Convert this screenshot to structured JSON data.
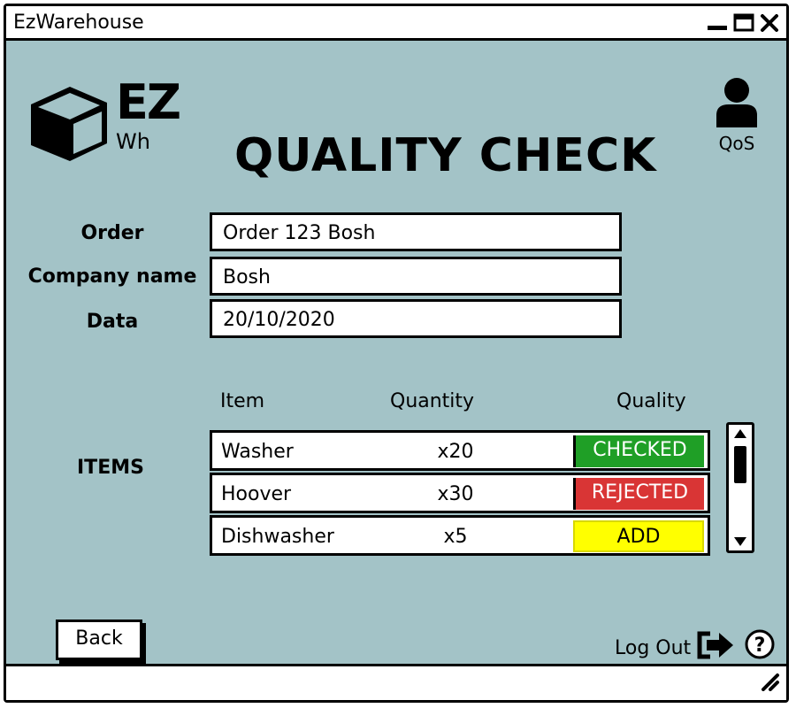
{
  "window": {
    "title": "EzWarehouse"
  },
  "logo": {
    "line1": "EZ",
    "line2": "Wh"
  },
  "page": {
    "title": "QUALITY CHECK"
  },
  "user": {
    "label": "QoS",
    "icon": "user-icon"
  },
  "form": {
    "order_label": "Order",
    "order_value": "Order 123 Bosh",
    "company_label": "Company name",
    "company_value": "Bosh",
    "date_label": "Data",
    "date_value": "20/10/2020"
  },
  "items": {
    "section_label": "ITEMS",
    "columns": [
      "Item",
      "Quantity",
      "Quality"
    ],
    "rows": [
      {
        "name": "Washer",
        "quantity": "x20",
        "quality": "CHECKED"
      },
      {
        "name": "Hoover",
        "quantity": "x30",
        "quality": "REJECTED"
      },
      {
        "name": "Dishwasher",
        "quantity": "x5",
        "quality": "ADD"
      }
    ]
  },
  "footer": {
    "back_label": "Back",
    "logout_label": "Log Out"
  },
  "colors": {
    "background": "#a3c3c7",
    "checked": "#1f9f26",
    "rejected": "#d93535",
    "add": "#ffff00"
  }
}
